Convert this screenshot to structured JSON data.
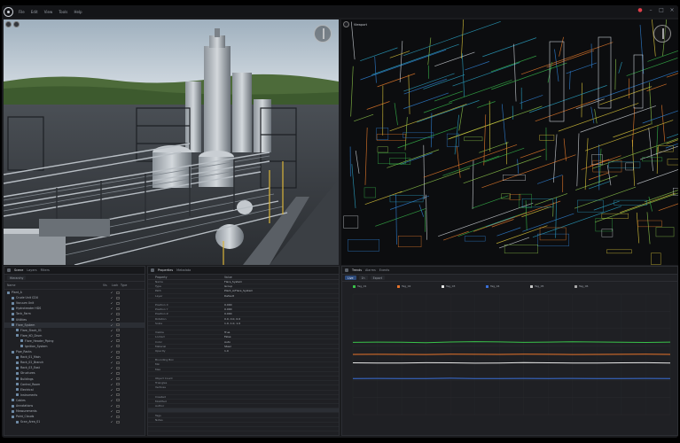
{
  "titlebar": {
    "menu": [
      "File",
      "Edit",
      "View",
      "Tools",
      "Help"
    ],
    "window_controls": [
      "notifications-icon",
      "minimize-icon",
      "maximize-icon",
      "close-icon"
    ]
  },
  "viewport_right": {
    "label": "Viewport"
  },
  "tree_panel": {
    "tabs": [
      "Scene",
      "Layers",
      "Filters"
    ],
    "subtabs": [
      "Hierarchy"
    ],
    "columns": [
      "Name",
      "Vis",
      "Lock",
      "Type"
    ],
    "rows": [
      {
        "name": "Plant_A",
        "level": 0
      },
      {
        "name": "Crude Unit CDU",
        "level": 1
      },
      {
        "name": "Vacuum Unit",
        "level": 1
      },
      {
        "name": "Hydrotreater HDS",
        "level": 1
      },
      {
        "name": "Tank_Farm",
        "level": 1
      },
      {
        "name": "Utilities",
        "level": 1
      },
      {
        "name": "Flare_System",
        "level": 1,
        "selected": true
      },
      {
        "name": "Flare_Stack_01",
        "level": 2
      },
      {
        "name": "Flare_KO_Drum",
        "level": 2
      },
      {
        "name": "Flare_Header_Piping",
        "level": 3
      },
      {
        "name": "Ignition_System",
        "level": 3
      },
      {
        "name": "Pipe_Racks",
        "level": 1
      },
      {
        "name": "Rack_01_Main",
        "level": 2
      },
      {
        "name": "Rack_02_Branch",
        "level": 2
      },
      {
        "name": "Rack_03_East",
        "level": 2
      },
      {
        "name": "Structures",
        "level": 2
      },
      {
        "name": "Buildings",
        "level": 2
      },
      {
        "name": "Control_Room",
        "level": 2
      },
      {
        "name": "Electrical",
        "level": 2
      },
      {
        "name": "Instruments",
        "level": 2
      },
      {
        "name": "Cables",
        "level": 1
      },
      {
        "name": "Annotations",
        "level": 1
      },
      {
        "name": "Measurements",
        "level": 1
      },
      {
        "name": "Point_Clouds",
        "level": 1
      },
      {
        "name": "Scan_Area_01",
        "level": 2
      }
    ]
  },
  "props_panel": {
    "tabs": [
      "Properties",
      "Metadata"
    ],
    "columns": [
      "Property",
      "Value"
    ],
    "rows": [
      {
        "k": "Name",
        "v": "Flare_System"
      },
      {
        "k": "Type",
        "v": "Group"
      },
      {
        "k": "Path",
        "v": "Plant_A/Flare_System"
      },
      {
        "k": "Layer",
        "v": "Default"
      },
      {
        "k": "",
        "v": ""
      },
      {
        "k": "Position X",
        "v": "0.000"
      },
      {
        "k": "Position Y",
        "v": "0.000"
      },
      {
        "k": "Position Z",
        "v": "0.000"
      },
      {
        "k": "Rotation",
        "v": "0.0, 0.0, 0.0"
      },
      {
        "k": "Scale",
        "v": "1.0, 1.0, 1.0"
      },
      {
        "k": "",
        "v": ""
      },
      {
        "k": "Visible",
        "v": "True"
      },
      {
        "k": "Locked",
        "v": "False"
      },
      {
        "k": "Color",
        "v": "Auto"
      },
      {
        "k": "Material",
        "v": "Steel"
      },
      {
        "k": "Opacity",
        "v": "1.0"
      },
      {
        "k": "",
        "v": ""
      },
      {
        "k": "Bounding Box",
        "v": ""
      },
      {
        "k": "Min",
        "v": ""
      },
      {
        "k": "Max",
        "v": ""
      },
      {
        "k": "",
        "v": ""
      },
      {
        "k": "Object Count",
        "v": ""
      },
      {
        "k": "Triangles",
        "v": ""
      },
      {
        "k": "Vertices",
        "v": ""
      },
      {
        "k": "",
        "v": ""
      },
      {
        "k": "Created",
        "v": ""
      },
      {
        "k": "Modified",
        "v": ""
      },
      {
        "k": "Author",
        "v": ""
      },
      {
        "k": "",
        "v": ""
      },
      {
        "k": "Tags",
        "v": ""
      },
      {
        "k": "Notes",
        "v": ""
      },
      {
        "k": "",
        "v": ""
      },
      {
        "k": "",
        "v": ""
      },
      {
        "k": "",
        "v": ""
      }
    ]
  },
  "trend_panel": {
    "tabs": [
      "Trends",
      "Alarms",
      "Events"
    ],
    "toolbar": [
      "Live",
      "1h",
      "Export"
    ],
    "legend": [
      {
        "name": "Tag_01",
        "color": "#39c24a"
      },
      {
        "name": "Tag_02",
        "color": "#e8742b"
      },
      {
        "name": "Tag_03",
        "color": "#e8e8e8"
      },
      {
        "name": "Tag_04",
        "color": "#3a6fd8"
      },
      {
        "name": "Tag_05",
        "color": "#c8c8c8"
      },
      {
        "name": "Tag_06",
        "color": "#aaaaaa"
      }
    ],
    "y_ticks": [
      "",
      "",
      "",
      "",
      "",
      "",
      "",
      ""
    ],
    "x_ticks": [
      "",
      "",
      "",
      "",
      "",
      "",
      "",
      "",
      "",
      "",
      "",
      "",
      "",
      ""
    ]
  },
  "colors": {
    "bg": "#1b1c1f",
    "panel": "#1f2024",
    "accent": "#4a7fd6",
    "close_red": "#e0404a"
  },
  "chart_data": {
    "type": "line",
    "series": [
      {
        "name": "Tag_01",
        "color": "#39c24a",
        "values": [
          60,
          60.2,
          60.1,
          59.8,
          60.3,
          60.6,
          60.4,
          60.0,
          60.2,
          60.5,
          60.3,
          60.1,
          59.9,
          60.2
        ]
      },
      {
        "name": "Tag_02",
        "color": "#e8742b",
        "values": [
          50,
          50.1,
          50.0,
          49.9,
          50.2,
          50.1,
          50.0,
          50.2,
          50.1,
          49.9,
          50.0,
          50.1,
          50.2,
          50.0
        ]
      },
      {
        "name": "Tag_03",
        "color": "#e8e8e8",
        "values": [
          43,
          42.8,
          42.9,
          43.1,
          43.0,
          42.7,
          42.9,
          43.2,
          43.0,
          42.9,
          42.8,
          43.0,
          43.1,
          42.9
        ]
      },
      {
        "name": "Tag_04",
        "color": "#3a6fd8",
        "values": [
          30,
          30.1,
          29.9,
          30.0,
          30.2,
          30.0,
          29.9,
          30.1,
          30.0,
          30.1,
          29.9,
          30.0,
          30.1,
          30.0
        ]
      }
    ],
    "ylim": [
      0,
      100
    ],
    "grid": true
  }
}
